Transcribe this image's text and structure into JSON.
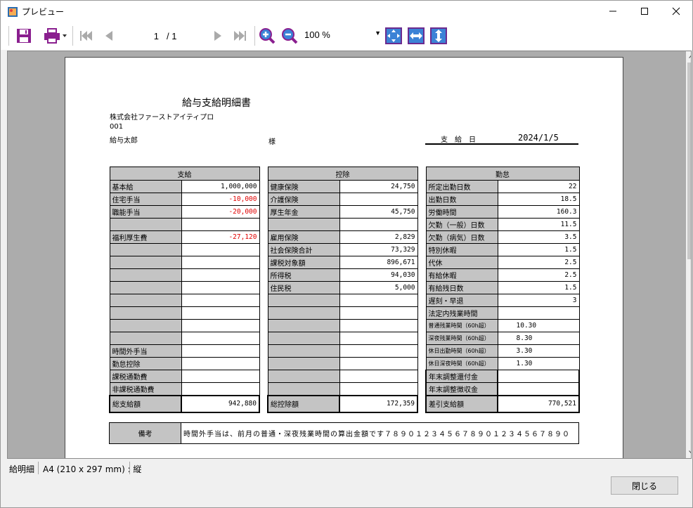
{
  "window": {
    "title": "プレビュー"
  },
  "toolbar": {
    "page_current": "1",
    "page_total": "/ 1",
    "zoom": "100 %"
  },
  "report": {
    "title": "給与支給明細書",
    "company": "株式会社ファーストアイティプロ",
    "employee_code": "001",
    "employee_name": "給与太郎",
    "honorific": "様",
    "pay_date_label": "支　給　日",
    "pay_date": "2024/1/5",
    "payments": {
      "header": "支給",
      "rows": [
        {
          "label": "基本給",
          "value": "1,000,000",
          "neg": false
        },
        {
          "label": "住宅手当",
          "value": "-10,000",
          "neg": true
        },
        {
          "label": "職能手当",
          "value": "-20,000",
          "neg": true
        },
        {
          "label": "",
          "value": "",
          "neg": false
        },
        {
          "label": "福利厚生費",
          "value": "-27,120",
          "neg": true
        },
        {
          "label": "",
          "value": "",
          "neg": false
        },
        {
          "label": "",
          "value": "",
          "neg": false
        },
        {
          "label": "",
          "value": "",
          "neg": false
        },
        {
          "label": "",
          "value": "",
          "neg": false
        },
        {
          "label": "",
          "value": "",
          "neg": false
        },
        {
          "label": "",
          "value": "",
          "neg": false
        },
        {
          "label": "",
          "value": "",
          "neg": false
        },
        {
          "label": "",
          "value": "",
          "neg": false
        },
        {
          "label": "時間外手当",
          "value": "",
          "neg": false
        },
        {
          "label": "勤怠控除",
          "value": "",
          "neg": false
        },
        {
          "label": "課税通勤費",
          "value": "",
          "neg": false
        },
        {
          "label": "非課税通勤費",
          "value": "",
          "neg": false
        }
      ],
      "total_label": "総支給額",
      "total_value": "942,880"
    },
    "deductions": {
      "header": "控除",
      "rows": [
        {
          "label": "健康保険",
          "value": "24,750"
        },
        {
          "label": "介護保険",
          "value": ""
        },
        {
          "label": "厚生年金",
          "value": "45,750"
        },
        {
          "label": "",
          "value": ""
        },
        {
          "label": "雇用保険",
          "value": "2,829"
        },
        {
          "label": "社会保険合計",
          "value": "73,329"
        },
        {
          "label": "課税対象額",
          "value": "896,671"
        },
        {
          "label": "所得税",
          "value": "94,030"
        },
        {
          "label": "住民税",
          "value": "5,000"
        },
        {
          "label": "",
          "value": ""
        },
        {
          "label": "",
          "value": ""
        },
        {
          "label": "",
          "value": ""
        },
        {
          "label": "",
          "value": ""
        },
        {
          "label": "",
          "value": ""
        },
        {
          "label": "",
          "value": ""
        },
        {
          "label": "",
          "value": ""
        },
        {
          "label": "",
          "value": ""
        }
      ],
      "total_label": "総控除額",
      "total_value": "172,359"
    },
    "attendance": {
      "header": "勤怠",
      "rows": [
        {
          "label": "所定出勤日数",
          "value": "22",
          "small": false
        },
        {
          "label": "出勤日数",
          "value": "18.5",
          "small": false
        },
        {
          "label": "労働時間",
          "value": "160.3",
          "small": false
        },
        {
          "label": "欠勤（一般）日数",
          "value": "11.5",
          "small": false
        },
        {
          "label": "欠勤（病気）日数",
          "value": "3.5",
          "small": false
        },
        {
          "label": "特別休暇",
          "value": "1.5",
          "small": false
        },
        {
          "label": "代休",
          "value": "2.5",
          "small": false
        },
        {
          "label": "有給休暇",
          "value": "2.5",
          "small": false
        },
        {
          "label": "有給残日数",
          "value": "1.5",
          "small": false
        },
        {
          "label": "遅刻・早退",
          "value": "3",
          "small": false
        },
        {
          "label": "法定内残業時間",
          "value": "",
          "small": false
        },
        {
          "label": "普通残業時間（60h超）",
          "value": "10.30",
          "small": true
        },
        {
          "label": "深夜残業時間（60h超）",
          "value": "8.30",
          "small": true
        },
        {
          "label": "休日出勤時間（60h超）",
          "value": "3.30",
          "small": true
        },
        {
          "label": "休日深夜時間（60h超）",
          "value": "1.30",
          "small": true
        },
        {
          "label": "年末調整還付金",
          "value": "",
          "small": false
        },
        {
          "label": "年末調整徴収金",
          "value": "",
          "small": false
        }
      ],
      "total_label": "差引支給額",
      "total_value": "770,521"
    },
    "remarks": {
      "label": "備考",
      "text": "時間外手当は、前月の普通・深夜残業時間の算出金額です７８９０１２３４５６７８９０１２３４５６７８９０"
    }
  },
  "status": {
    "name": "給明細",
    "paper": "A4 (210 x 297 mm) : 縦"
  },
  "close_label": "閉じる"
}
